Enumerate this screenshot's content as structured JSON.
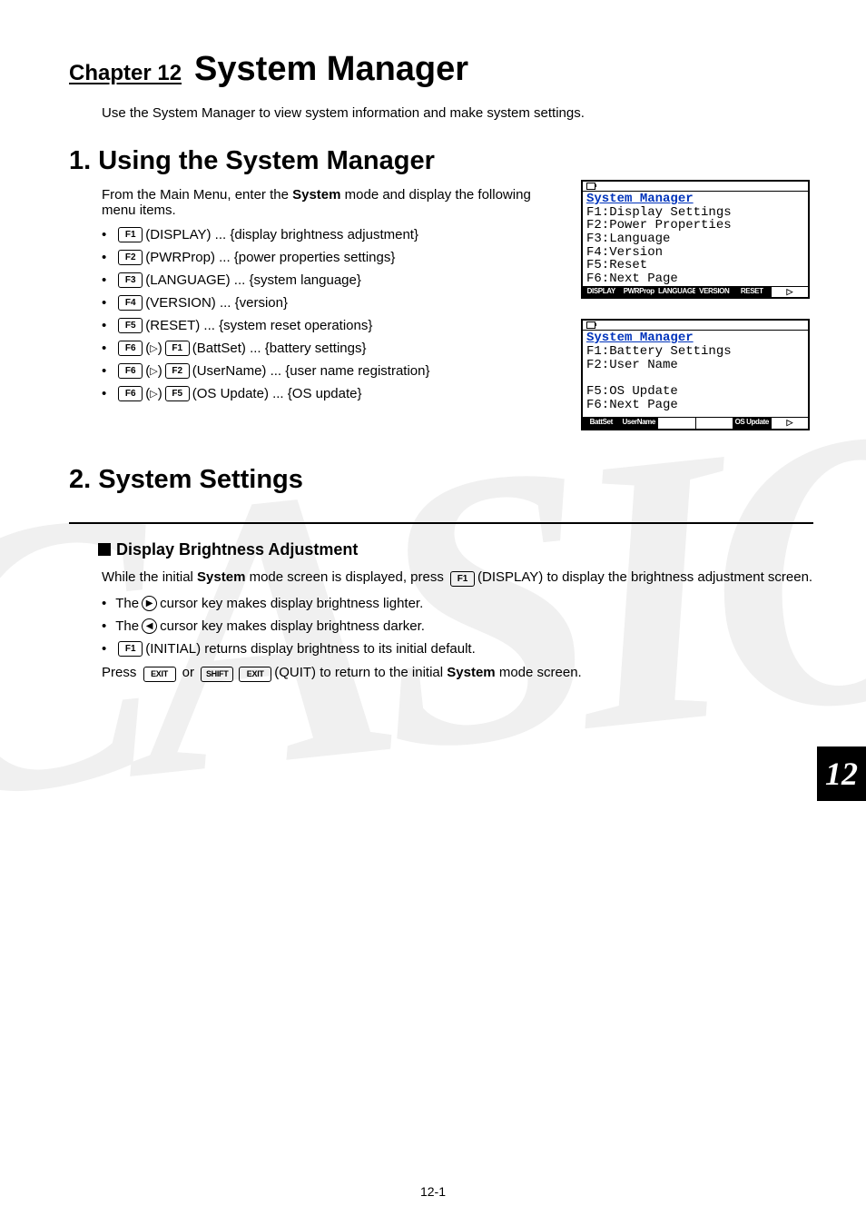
{
  "chapter": {
    "label": "Chapter 12",
    "title": "System Manager",
    "number": "12"
  },
  "intro": "Use the System Manager to view system information and make system settings.",
  "section1": {
    "title": "1. Using the System Manager",
    "intro_pre": "From the Main Menu, enter the ",
    "intro_bold": "System",
    "intro_post": " mode and display the following menu items.",
    "items": [
      {
        "keys": [
          "F1"
        ],
        "label": "(DISPLAY) ... {display brightness adjustment}"
      },
      {
        "keys": [
          "F2"
        ],
        "label": "(PWRProp) ... {power properties settings}"
      },
      {
        "keys": [
          "F3"
        ],
        "label": "(LANGUAGE) ... {system language}"
      },
      {
        "keys": [
          "F4"
        ],
        "label": "(VERSION) ... {version}"
      },
      {
        "keys": [
          "F5"
        ],
        "label": "(RESET) ... {system reset operations}"
      },
      {
        "keys": [
          "F6",
          "▷",
          "F1"
        ],
        "label": "(BattSet) ... {battery settings}"
      },
      {
        "keys": [
          "F6",
          "▷",
          "F2"
        ],
        "label": "(UserName) ... {user name registration}"
      },
      {
        "keys": [
          "F6",
          "▷",
          "F5"
        ],
        "label": "(OS Update) ... {OS update}"
      }
    ]
  },
  "screens": {
    "a": {
      "title": "System Manager",
      "lines": [
        "F1:Display Settings",
        "F2:Power Properties",
        "F3:Language",
        "F4:Version",
        "F5:Reset",
        "F6:Next Page"
      ],
      "tabs": [
        "DISPLAY",
        "PWRProp",
        "LANGUAGE",
        "VERSION",
        "RESET",
        "▷"
      ]
    },
    "b": {
      "title": "System Manager",
      "lines": [
        "F1:Battery Settings",
        "F2:User Name",
        "",
        "F5:OS Update",
        "F6:Next Page"
      ],
      "tabs": [
        "BattSet",
        "UserName",
        "",
        "",
        "OS Update",
        "▷"
      ]
    }
  },
  "section2": {
    "title": "2. System Settings",
    "sub": "Display Brightness Adjustment",
    "p1_pre": "While the initial ",
    "p1_bold": "System",
    "p1_mid": " mode screen is displayed, press ",
    "p1_key": "F1",
    "p1_post": "(DISPLAY) to display the brightness adjustment screen.",
    "b1_pre": "The ",
    "b1_post": " cursor key makes display brightness lighter.",
    "b2_pre": "The ",
    "b2_post": " cursor key makes display brightness darker.",
    "b3_key": "F1",
    "b3_text": "(INITIAL) returns display brightness to its initial default.",
    "p2_pre": "Press ",
    "p2_k1": "EXIT",
    "p2_or": " or ",
    "p2_k2": "SHIFT",
    "p2_k3": "EXIT",
    "p2_mid": "(QUIT) to return to the initial ",
    "p2_bold": "System",
    "p2_post": " mode screen."
  },
  "page_number": "12-1"
}
